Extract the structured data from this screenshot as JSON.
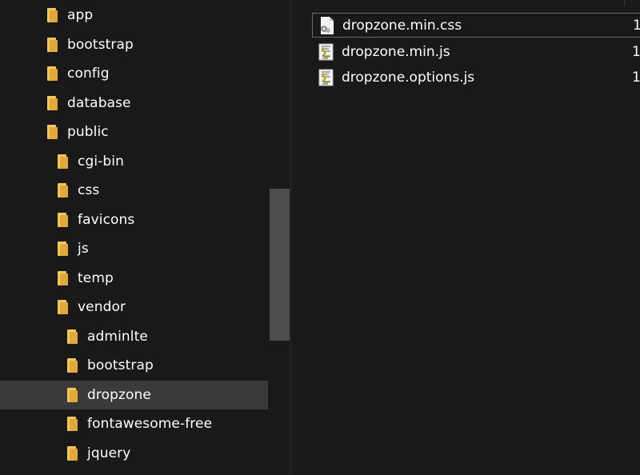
{
  "navigation": {
    "items": [
      {
        "label": "app",
        "level": 0
      },
      {
        "label": "bootstrap",
        "level": 0
      },
      {
        "label": "config",
        "level": 0
      },
      {
        "label": "database",
        "level": 0
      },
      {
        "label": "public",
        "level": 0
      },
      {
        "label": "cgi-bin",
        "level": 1
      },
      {
        "label": "css",
        "level": 1
      },
      {
        "label": "favicons",
        "level": 1
      },
      {
        "label": "js",
        "level": 1
      },
      {
        "label": "temp",
        "level": 1
      },
      {
        "label": "vendor",
        "level": 1
      },
      {
        "label": "adminlte",
        "level": 2
      },
      {
        "label": "bootstrap",
        "level": 2
      },
      {
        "label": "dropzone",
        "level": 2,
        "selected": true
      },
      {
        "label": "fontawesome-free",
        "level": 2
      },
      {
        "label": "jquery",
        "level": 2
      }
    ]
  },
  "files": [
    {
      "name": "dropzone.min.css",
      "type": "css-file-icon",
      "extra": "1"
    },
    {
      "name": "dropzone.min.js",
      "type": "js-file-icon",
      "extra": "1"
    },
    {
      "name": "dropzone.options.js",
      "type": "js-file-icon",
      "extra": "1"
    }
  ],
  "colors": {
    "background": "#191919",
    "selection": "#3a3a3a",
    "folder": "#f3c75b",
    "scroll_thumb": "#4d4d4d",
    "focus_border": "#6b6b6b"
  }
}
